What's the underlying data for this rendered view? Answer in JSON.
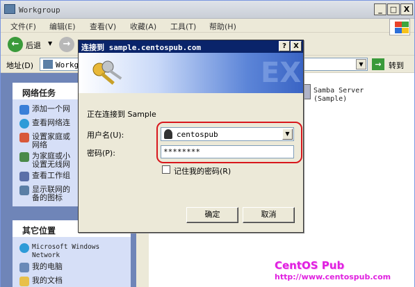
{
  "window": {
    "title": "Workgroup",
    "close": "X",
    "maximize": "□",
    "minimize": "_"
  },
  "menu": [
    "文件(F)",
    "编辑(E)",
    "查看(V)",
    "收藏(A)",
    "工具(T)",
    "帮助(H)"
  ],
  "toolbar": {
    "back_label": "后退"
  },
  "address": {
    "label": "地址(D)",
    "value": "Workg",
    "go_label": "转到"
  },
  "network_tasks": {
    "title": "网络任务",
    "items": [
      "添加一个网",
      "查看网络连",
      "设置家庭或\n网络",
      "为家庭或小\n设置无线网",
      "查看工作组",
      "显示联网的\n备的图标"
    ]
  },
  "other_places": {
    "title": "其它位置",
    "items": [
      "Microsoft Windows\nNetwork",
      "我的电脑",
      "我的文档"
    ]
  },
  "content": {
    "server_name": "Samba Server\n(Sample)"
  },
  "watermark": {
    "line1": "CentOS Pub",
    "line2": "http://www.centospub.com"
  },
  "dialog": {
    "title": "连接到 sample.centospub.com",
    "help": "?",
    "close": "X",
    "connecting_text": "正在连接到 Sample",
    "username_label": "用户名(U):",
    "username_value": "centospub",
    "password_label": "密码(P):",
    "password_value": "********",
    "remember_label": "记住我的密码(R)",
    "ok": "确定",
    "cancel": "取消"
  },
  "colors": {
    "highlight": "#d8171c",
    "titlebar": "#0a246a",
    "watermark": "#e020e0"
  }
}
